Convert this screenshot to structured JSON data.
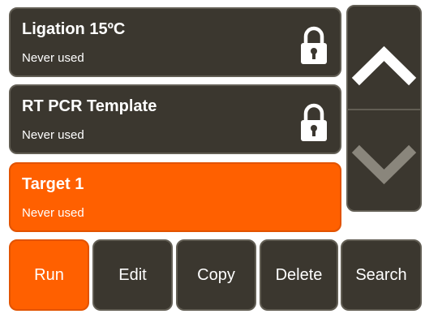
{
  "protocols": [
    {
      "name": "Ligation 15ºC",
      "status": "Never used",
      "locked": true,
      "selected": false
    },
    {
      "name": "RT PCR Template",
      "status": "Never used",
      "locked": true,
      "selected": false
    },
    {
      "name": "Target 1",
      "status": "Never used",
      "locked": false,
      "selected": true
    }
  ],
  "scroll": {
    "up_icon": "chevron-up-icon",
    "down_icon": "chevron-down-icon"
  },
  "actions": {
    "run_label": "Run",
    "edit_label": "Edit",
    "copy_label": "Copy",
    "delete_label": "Delete",
    "search_label": "Search"
  },
  "colors": {
    "accent": "#ff6000",
    "panel": "#3b372f",
    "panel_border": "#625e54",
    "text": "#ffffff"
  }
}
